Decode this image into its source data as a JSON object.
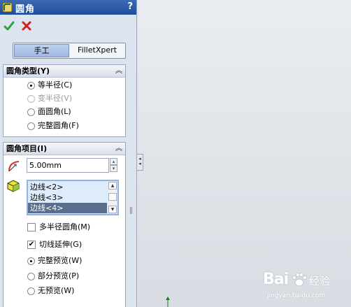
{
  "panel": {
    "title": "圆角",
    "help": "?",
    "tabs": {
      "manual": "手工",
      "xpert": "FilletXpert"
    }
  },
  "fillet_type": {
    "header": "圆角类型(Y)",
    "collapse": "︽",
    "options": [
      {
        "label": "等半径(C)",
        "selected": true,
        "enabled": true
      },
      {
        "label": "变半径(V)",
        "selected": false,
        "enabled": false
      },
      {
        "label": "面圆角(L)",
        "selected": false,
        "enabled": true
      },
      {
        "label": "完整圆角(F)",
        "selected": false,
        "enabled": true
      }
    ]
  },
  "fillet_items": {
    "header": "圆角项目(I)",
    "collapse": "︽",
    "radius": "5.00mm",
    "edges": [
      "边线<2>",
      "边线<3>",
      "边线<4>"
    ],
    "selected_edge": "边线<4>",
    "multi_radius": {
      "label": "多半径圆角(M)",
      "checked": false
    },
    "tangent_propagation": {
      "label": "切线延伸(G)",
      "checked": true,
      "mark": "✔"
    },
    "preview": [
      {
        "label": "完整预览(W)",
        "selected": true
      },
      {
        "label": "部分预览(P)",
        "selected": false
      },
      {
        "label": "无预览(W)",
        "selected": false
      }
    ]
  },
  "watermark": {
    "brand": "Bai",
    "brand_tail": "经验",
    "url": "jingyan.baidu.com"
  },
  "colors": {
    "title_bar": "#1e4f9c",
    "ok": "#2aa33a",
    "cancel": "#d11f1f",
    "selected_row": "#5a6d8d"
  }
}
